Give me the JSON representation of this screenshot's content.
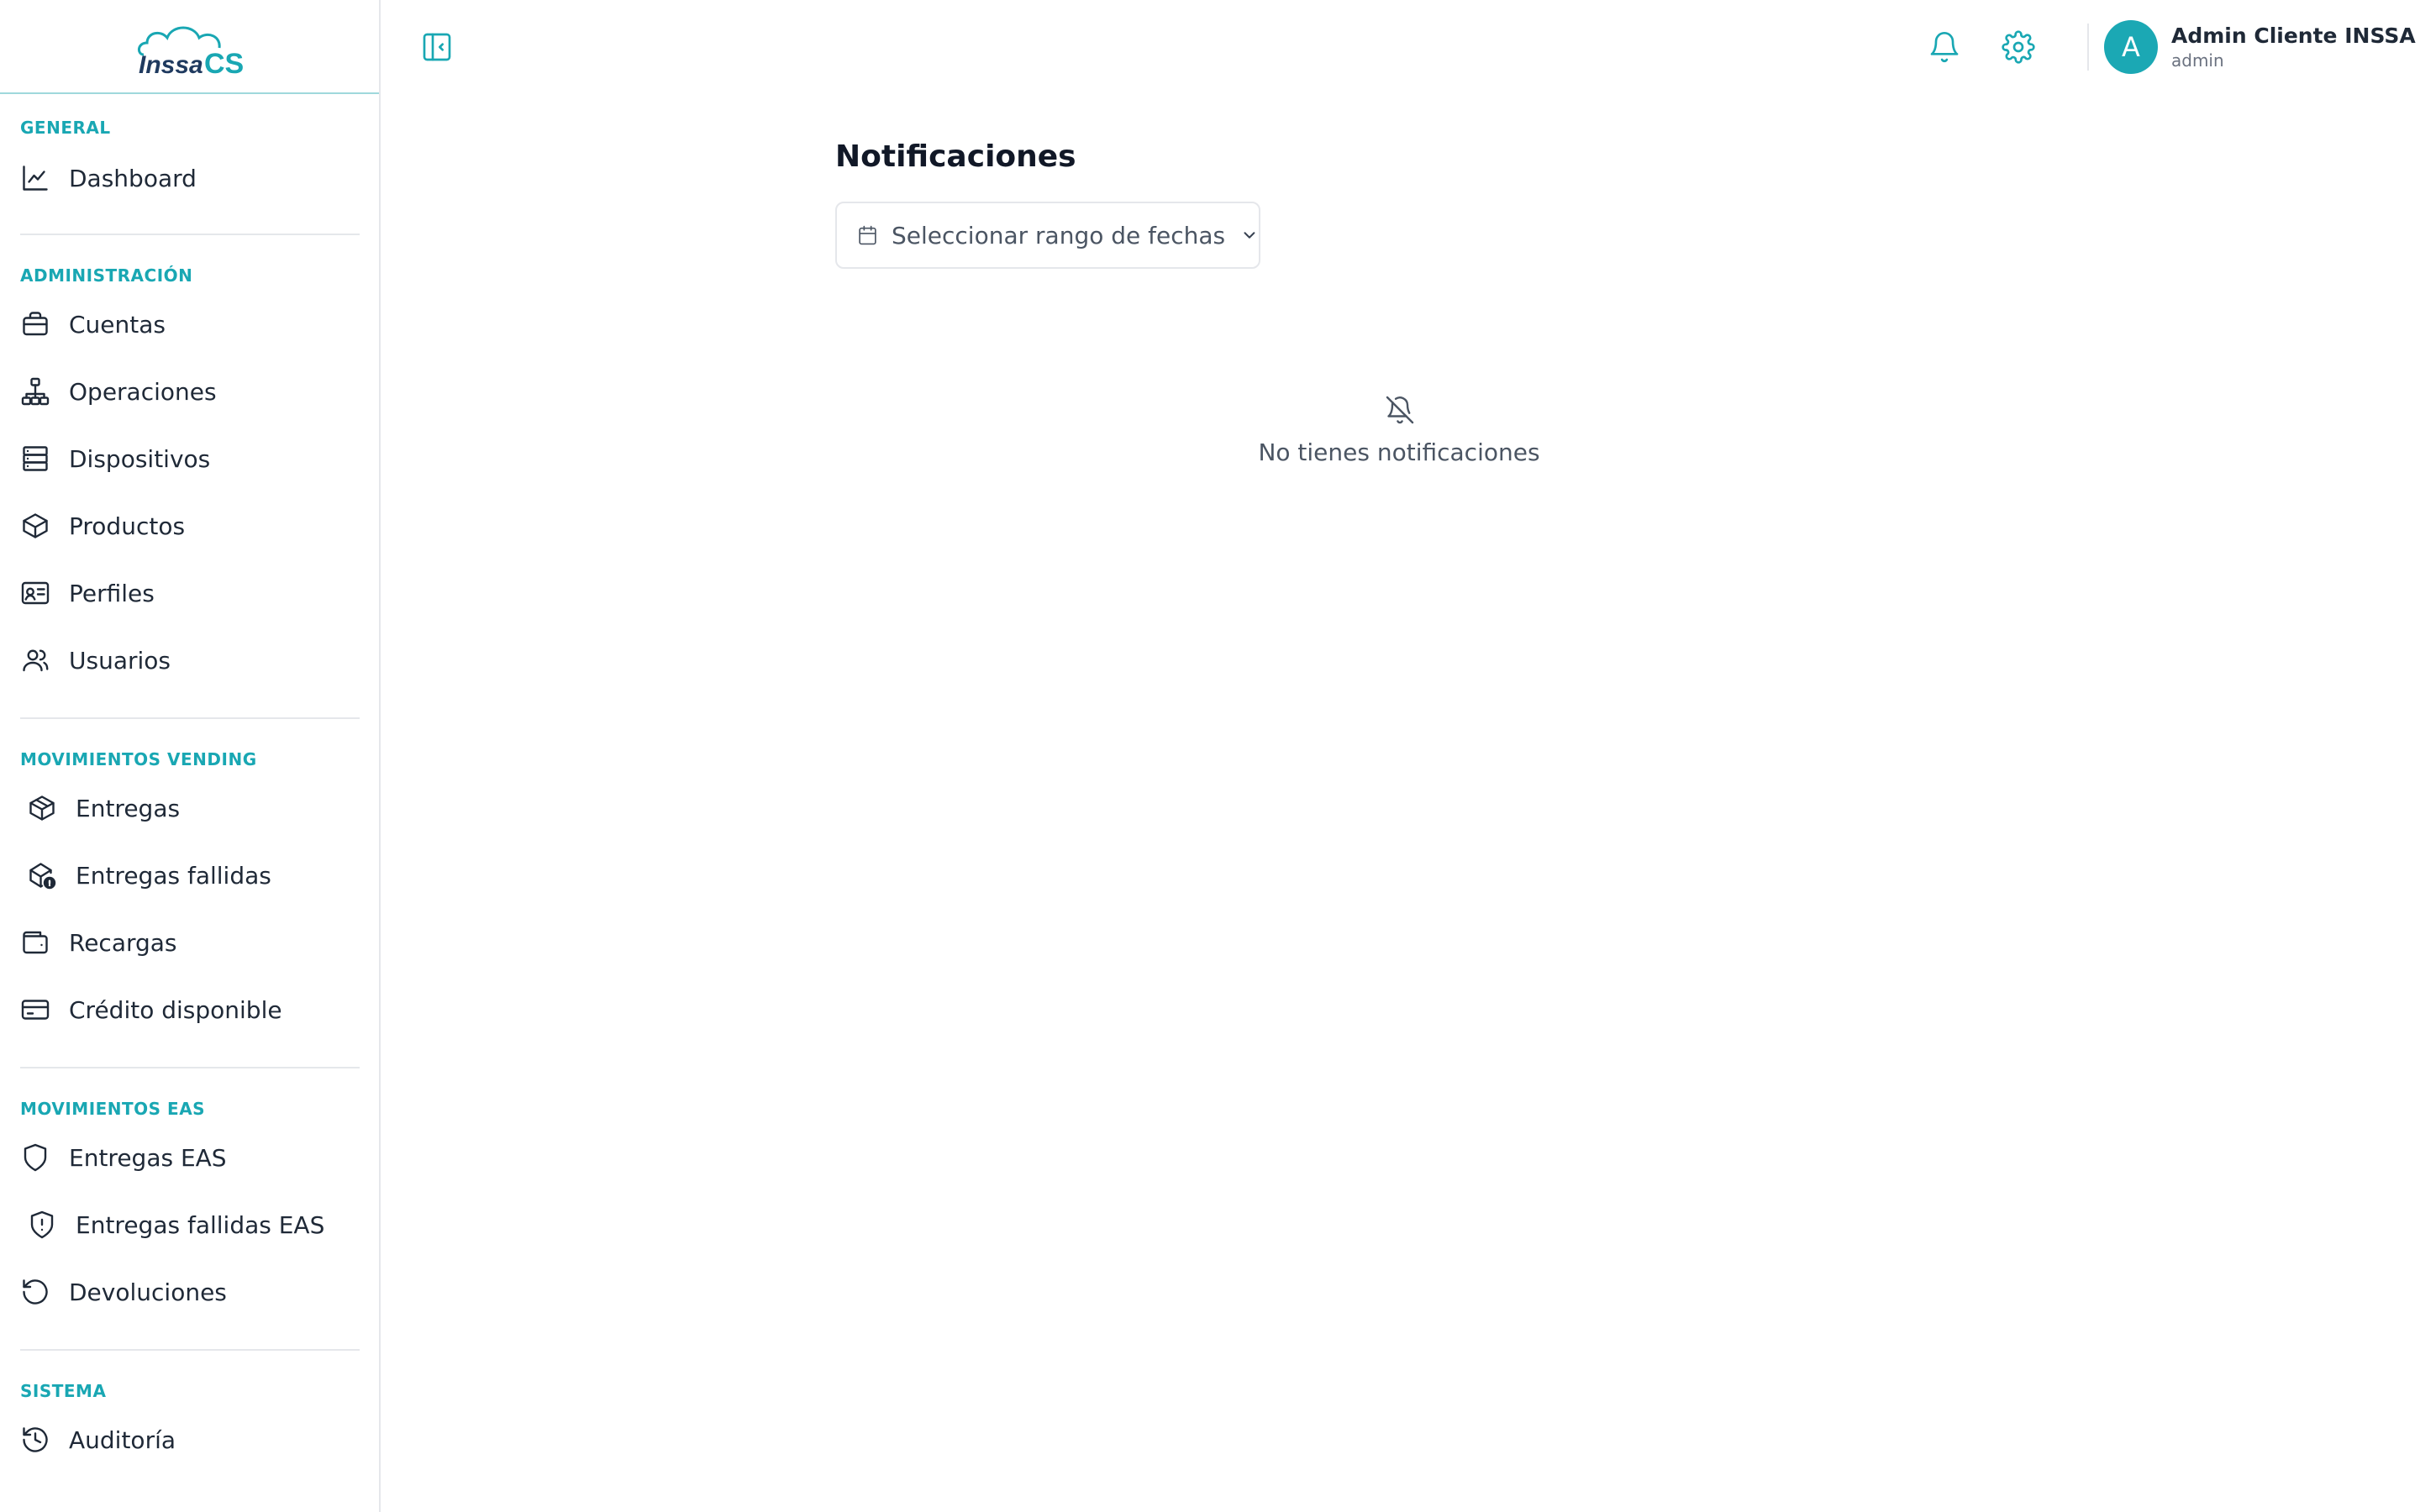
{
  "logo": {
    "text": "Inssa",
    "suffix": "CS"
  },
  "sidebar": {
    "sections": [
      {
        "label": "GENERAL",
        "items": [
          {
            "label": "Dashboard",
            "icon": "chart-line-icon"
          }
        ]
      },
      {
        "label": "ADMINISTRACIÓN",
        "items": [
          {
            "label": "Cuentas",
            "icon": "briefcase-icon"
          },
          {
            "label": "Operaciones",
            "icon": "network-icon"
          },
          {
            "label": "Dispositivos",
            "icon": "server-icon"
          },
          {
            "label": "Productos",
            "icon": "box-icon"
          },
          {
            "label": "Perfiles",
            "icon": "id-card-icon"
          },
          {
            "label": "Usuarios",
            "icon": "users-icon"
          }
        ]
      },
      {
        "label": "MOVIMIENTOS VENDING",
        "items": [
          {
            "label": "Entregas",
            "icon": "package-icon"
          },
          {
            "label": "Entregas fallidas",
            "icon": "package-alert-icon"
          },
          {
            "label": "Recargas",
            "icon": "wallet-icon"
          },
          {
            "label": "Crédito disponible",
            "icon": "credit-card-icon"
          }
        ]
      },
      {
        "label": "MOVIMIENTOS EAS",
        "items": [
          {
            "label": "Entregas EAS",
            "icon": "shield-icon"
          },
          {
            "label": "Entregas fallidas EAS",
            "icon": "shield-alert-icon"
          },
          {
            "label": "Devoluciones",
            "icon": "rotate-ccw-icon"
          }
        ]
      },
      {
        "label": "SISTEMA",
        "items": [
          {
            "label": "Auditoría",
            "icon": "history-icon"
          }
        ]
      }
    ]
  },
  "header": {
    "user_initial": "A",
    "user_name": "Admin Cliente INSSA",
    "user_role": "admin"
  },
  "main": {
    "title": "Notificaciones",
    "date_range_label": "Seleccionar rango de fechas",
    "empty_message": "No tienes notificaciones"
  },
  "colors": {
    "accent": "#19a7b3",
    "text": "#1f2937",
    "muted": "#4b5563",
    "border": "#e5e7eb"
  }
}
